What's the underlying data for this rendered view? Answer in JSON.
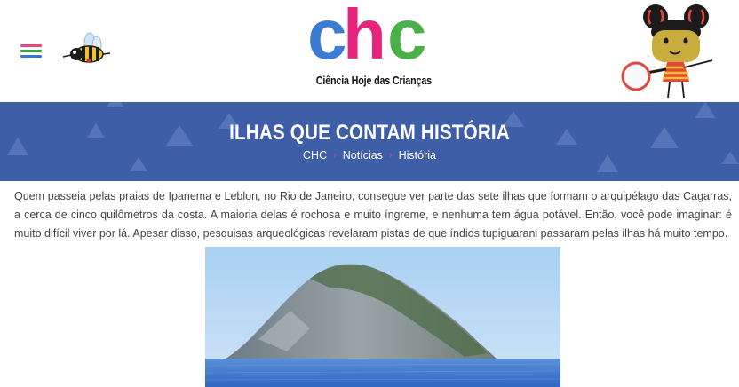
{
  "header": {
    "logo": {
      "text": "chc",
      "caption": "Ciência Hoje das Crianças"
    },
    "menu_icon": "hamburger-icon",
    "bee_icon": "bee-mascot",
    "mascot": "girl-with-magnifier-mascot"
  },
  "banner": {
    "title": "ILHAS QUE CONTAM HISTÓRIA",
    "breadcrumb": [
      "CHC",
      "Notícias",
      "História"
    ],
    "separator": "›"
  },
  "article": {
    "paragraph": "Quem passeia pelas praias de Ipanema e Leblon, no Rio de Janeiro, consegue ver parte das sete ilhas que formam o arquipélago das Cagarras, a cerca de cinco quilômetros da costa. A maioria delas é rochosa e muito íngreme, e nenhuma tem água potável. Então, você pode imaginar: é muito difícil viver por lá. Apesar disso, pesquisas arqueológicas revelaram pistas de que índios tupiguarani passaram pelas ilhas há muito tempo."
  },
  "colors": {
    "banner_bg": "#3f5ea8",
    "logo_c1": "#3b7bd1",
    "logo_h": "#e8237b",
    "logo_c2": "#49b04a",
    "breadcrumb_separator": "#e0447a"
  }
}
